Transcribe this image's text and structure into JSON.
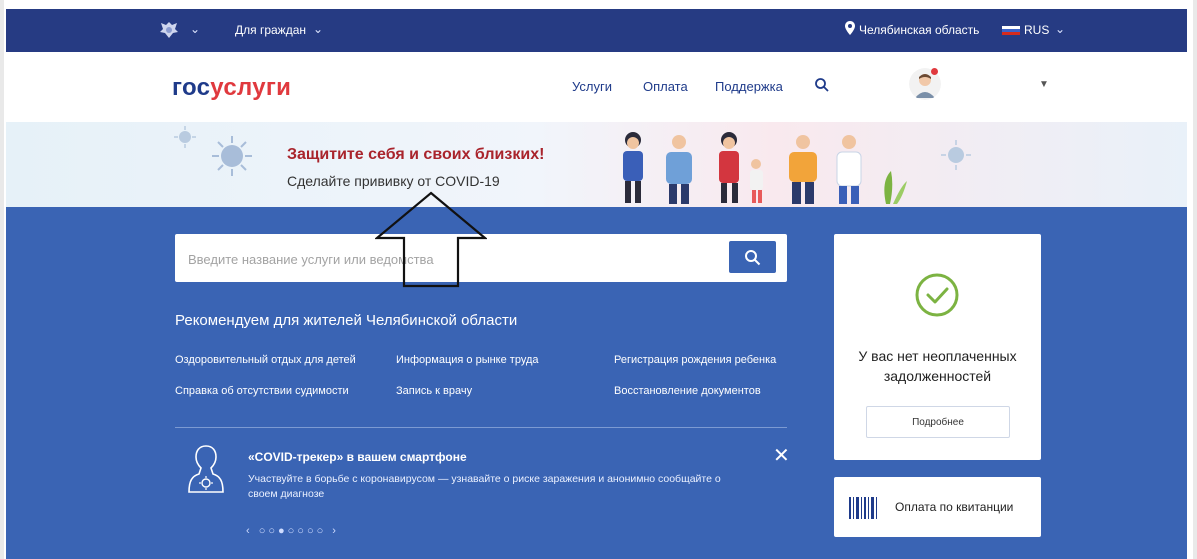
{
  "topbar": {
    "for_citizens": "Для граждан",
    "region": "Челябинская область",
    "language": "RUS"
  },
  "header": {
    "logo_part1": "гос",
    "logo_part2": "услуги",
    "nav": [
      "Услуги",
      "Оплата",
      "Поддержка"
    ]
  },
  "banner": {
    "title": "Защитите себя и своих близких!",
    "subtitle": "Сделайте прививку от COVID-19"
  },
  "search": {
    "placeholder": "Введите название услуги или ведомства"
  },
  "recommend": {
    "title": "Рекомендуем для жителей Челябинской области",
    "links": [
      "Оздоровительный отдых для детей",
      "Информация о рынке труда",
      "Регистрация рождения ребенка",
      "Справка об отсутствии судимости",
      "Запись к врачу",
      "Восстановление документов"
    ]
  },
  "tracker": {
    "title": "«COVID-трекер» в вашем смартфоне",
    "text": "Участвуйте в борьбе с коронавирусом — узнавайте о риске заражения и анонимно сообщайте о своем диагнозе",
    "pager": "‹  ○○●○○○○  ›"
  },
  "debt": {
    "text": "У вас нет неоплаченных задолженностей",
    "button": "Подробнее"
  },
  "payment": {
    "label": "Оплата по квитанции"
  },
  "colors": {
    "topbar": "#263b83",
    "main": "#3a64b4",
    "logo_blue": "#1f3b8a",
    "logo_red": "#e0393e",
    "banner_title": "#a9242c",
    "check_green": "#7cb342"
  }
}
